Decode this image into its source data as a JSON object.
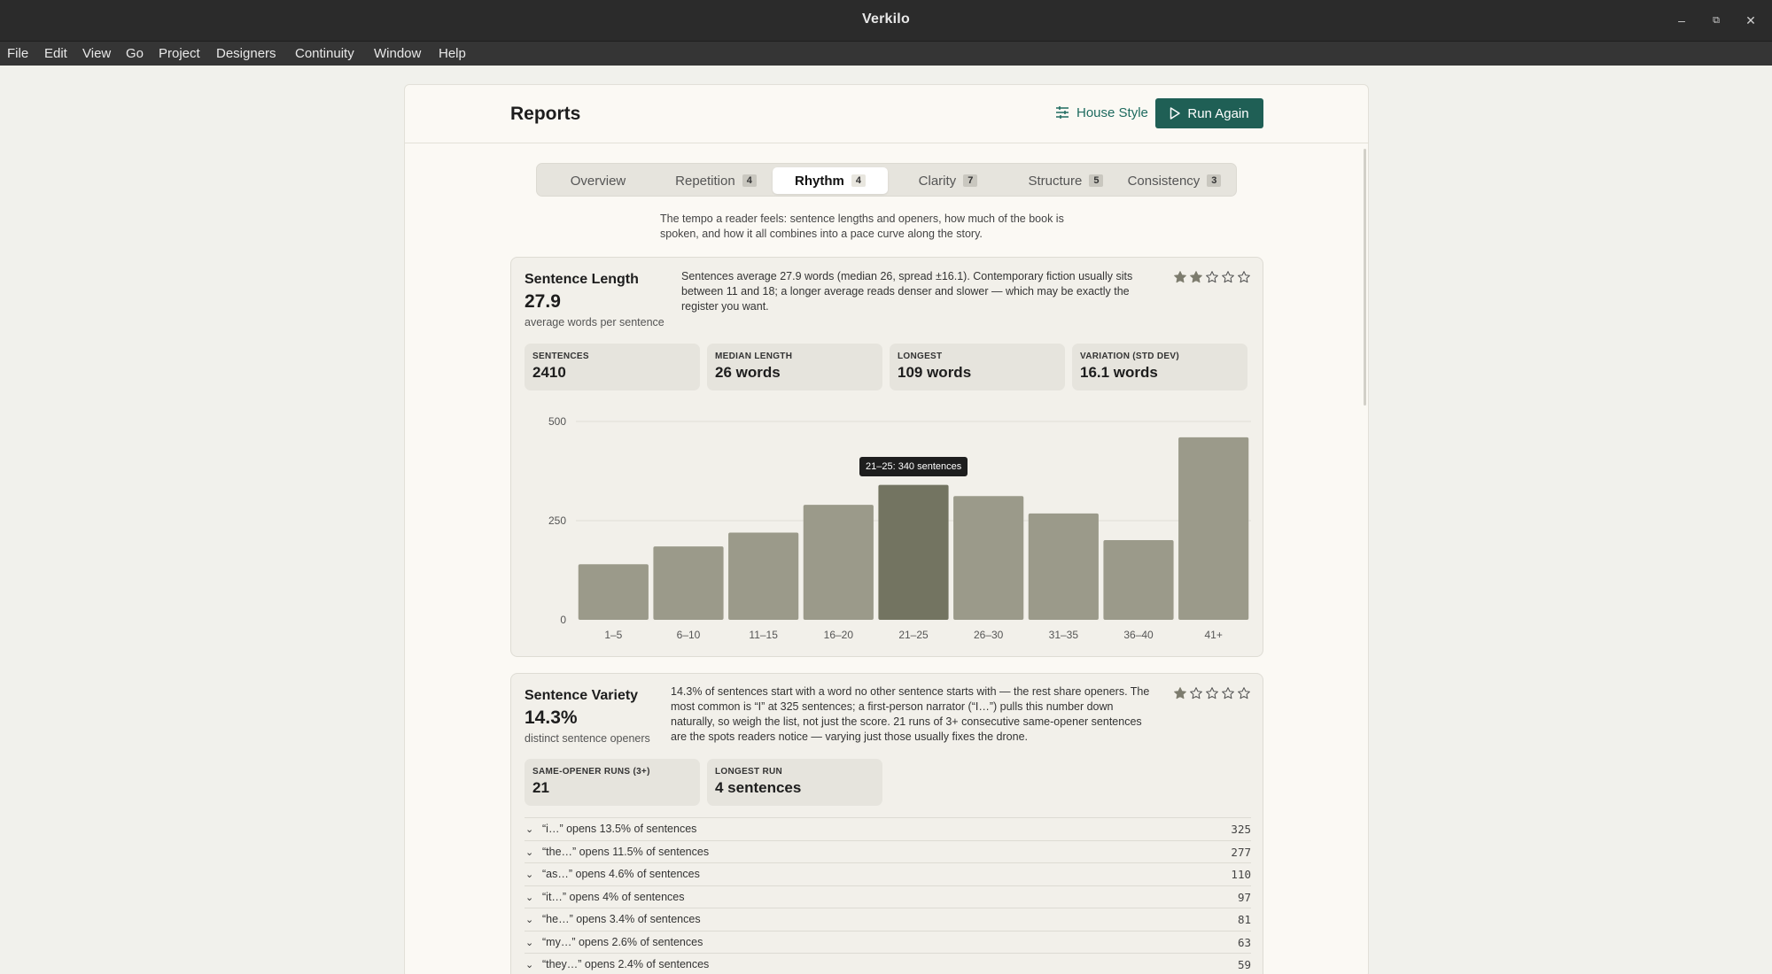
{
  "window": {
    "title": "Verkilo",
    "minimize": "–",
    "restore": "⧉",
    "close": "✕"
  },
  "menu": [
    "File",
    "Edit",
    "View",
    "Go",
    "Project",
    "Designers",
    "Continuity",
    "Window",
    "Help"
  ],
  "header": {
    "title": "Reports",
    "house_style": "House Style",
    "run_again": "Run Again"
  },
  "tabs": [
    {
      "label": "Overview",
      "badge": ""
    },
    {
      "label": "Repetition",
      "badge": "4"
    },
    {
      "label": "Rhythm",
      "badge": "4"
    },
    {
      "label": "Clarity",
      "badge": "7"
    },
    {
      "label": "Structure",
      "badge": "5"
    },
    {
      "label": "Consistency",
      "badge": "3"
    }
  ],
  "active_tab": "Rhythm",
  "description": "The tempo a reader feels: sentence lengths and openers, how much of the book is spoken, and how it all combines into a pace curve along the story.",
  "sentence_length": {
    "title": "Sentence Length",
    "value": "27.9",
    "subtitle": "average words per sentence",
    "description": "Sentences average 27.9 words (median 26, spread ±16.1). Contemporary fiction usually sits between 11 and 18; a longer average reads denser and slower — which may be exactly the register you want.",
    "rating": 2,
    "stats": [
      {
        "label": "SENTENCES",
        "value": "2410"
      },
      {
        "label": "MEDIAN LENGTH",
        "value": "26 words"
      },
      {
        "label": "LONGEST",
        "value": "109 words"
      },
      {
        "label": "VARIATION (STD DEV)",
        "value": "16.1 words"
      }
    ],
    "tooltip": "21–25: 340 sentences"
  },
  "chart_data": {
    "type": "bar",
    "categories": [
      "1–5",
      "6–10",
      "11–15",
      "16–20",
      "21–25",
      "26–30",
      "31–35",
      "36–40",
      "41+"
    ],
    "values": [
      140,
      185,
      220,
      290,
      340,
      312,
      268,
      201,
      460
    ],
    "highlighted": "21–25",
    "ylim": [
      0,
      500
    ],
    "yticks": [
      0,
      250,
      500
    ],
    "grid": true,
    "colors": {
      "bar": "#9b9a8a",
      "highlight": "#737461",
      "grid": "#e0ded6"
    }
  },
  "sentence_variety": {
    "title": "Sentence Variety",
    "value": "14.3%",
    "subtitle": "distinct sentence openers",
    "description": "14.3% of sentences start with a word no other sentence starts with — the rest share openers. The most common is “I” at 325 sentences; a first-person narrator (“I…”) pulls this number down naturally, so weigh the list, not just the score. 21 runs of 3+ consecutive same-opener sentences are the spots readers notice — varying just those usually fixes the drone.",
    "rating": 1,
    "stats": [
      {
        "label": "SAME-OPENER RUNS (3+)",
        "value": "21"
      },
      {
        "label": "LONGEST RUN",
        "value": "4 sentences"
      }
    ],
    "openers": [
      {
        "text": "“i…” opens 13.5% of sentences",
        "count": "325"
      },
      {
        "text": "“the…” opens 11.5% of sentences",
        "count": "277"
      },
      {
        "text": "“as…” opens 4.6% of sentences",
        "count": "110"
      },
      {
        "text": "“it…” opens 4% of sentences",
        "count": "97"
      },
      {
        "text": "“he…” opens 3.4% of sentences",
        "count": "81"
      },
      {
        "text": "“my…” opens 2.6% of sentences",
        "count": "63"
      },
      {
        "text": "“they…” opens 2.4% of sentences",
        "count": "59"
      }
    ]
  },
  "colors": {
    "accent": "#1f5f55",
    "star": "#7d7c6e"
  }
}
